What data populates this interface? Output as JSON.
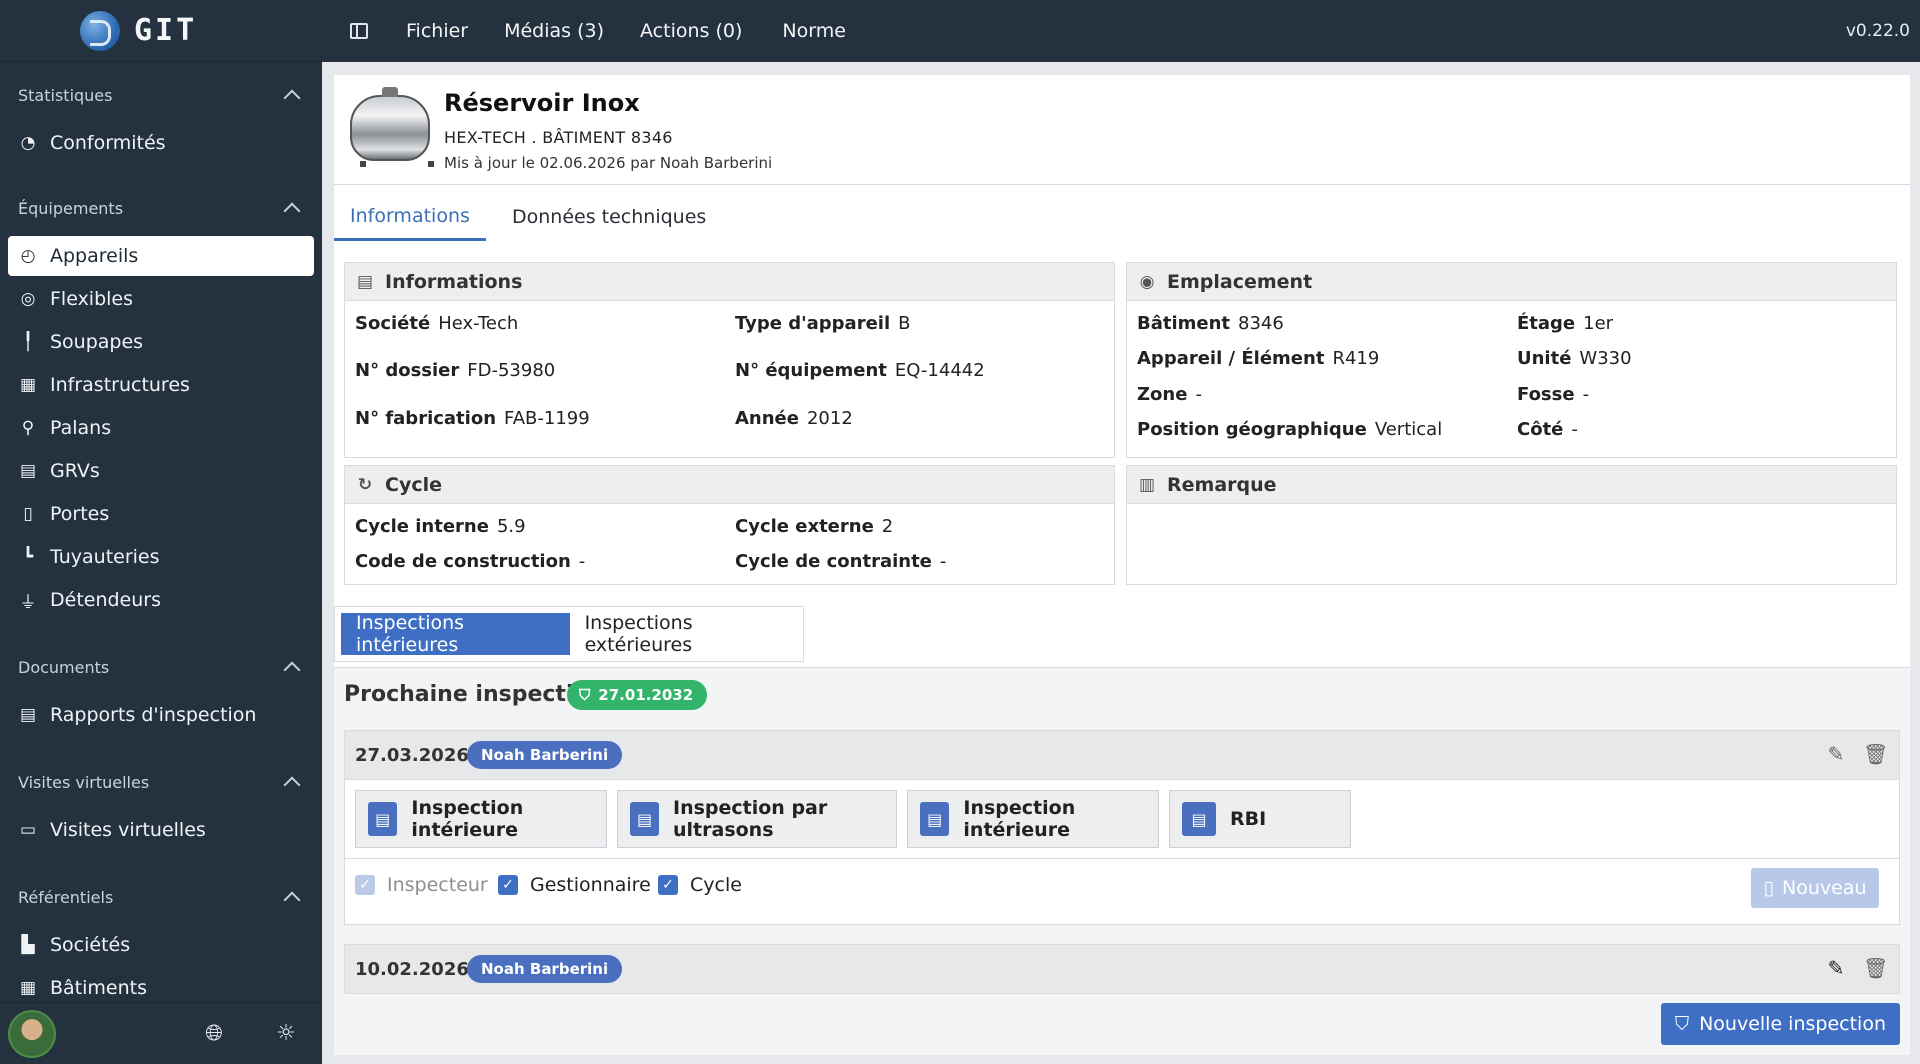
{
  "app": {
    "name": "GIT",
    "version": "v0.22.0"
  },
  "topbar": {
    "menu": [
      "Fichier",
      "Médias (3)",
      "Actions (0)",
      "Norme"
    ]
  },
  "sidebar": {
    "sections": [
      {
        "title": "Statistiques",
        "items": [
          {
            "label": "Conformités",
            "icon": "pie-chart-icon"
          }
        ]
      },
      {
        "title": "Équipements",
        "items": [
          {
            "label": "Appareils",
            "icon": "gauge-icon",
            "active": true
          },
          {
            "label": "Flexibles",
            "icon": "coil-icon"
          },
          {
            "label": "Soupapes",
            "icon": "valve-icon"
          },
          {
            "label": "Infrastructures",
            "icon": "building-icon"
          },
          {
            "label": "Palans",
            "icon": "hoist-icon"
          },
          {
            "label": "GRVs",
            "icon": "container-icon"
          },
          {
            "label": "Portes",
            "icon": "door-icon"
          },
          {
            "label": "Tuyauteries",
            "icon": "pipe-icon"
          },
          {
            "label": "Détendeurs",
            "icon": "regulator-icon"
          }
        ]
      },
      {
        "title": "Documents",
        "items": [
          {
            "label": "Rapports d'inspection",
            "icon": "document-icon"
          }
        ]
      },
      {
        "title": "Visites virtuelles",
        "items": [
          {
            "label": "Visites virtuelles",
            "icon": "panorama-icon"
          }
        ]
      },
      {
        "title": "Référentiels",
        "items": [
          {
            "label": "Sociétés",
            "icon": "factory-icon"
          },
          {
            "label": "Bâtiments",
            "icon": "building-icon"
          }
        ]
      }
    ]
  },
  "equipment": {
    "title": "Réservoir Inox",
    "subtitle": "HEX-TECH . BÂTIMENT 8346",
    "updated": "Mis à jour le 02.06.2026 par Noah Barberini"
  },
  "tabs": {
    "informations": "Informations",
    "technical": "Données techniques"
  },
  "informations": {
    "title": "Informations",
    "fields": [
      {
        "label": "Société",
        "value": "Hex-Tech"
      },
      {
        "label": "Type d'appareil",
        "value": "B"
      },
      {
        "label": "N° dossier",
        "value": "FD-53980"
      },
      {
        "label": "N° équipement",
        "value": "EQ-14442"
      },
      {
        "label": "N° fabrication",
        "value": "FAB-1199"
      },
      {
        "label": "Année",
        "value": "2012"
      }
    ]
  },
  "location": {
    "title": "Emplacement",
    "fields": [
      {
        "label": "Bâtiment",
        "value": "8346"
      },
      {
        "label": "Étage",
        "value": "1er"
      },
      {
        "label": "Appareil / Élément",
        "value": "R419"
      },
      {
        "label": "Unité",
        "value": "W330"
      },
      {
        "label": "Zone",
        "value": "-"
      },
      {
        "label": "Fosse",
        "value": "-"
      },
      {
        "label": "Position géographique",
        "value": "Vertical"
      },
      {
        "label": "Côté",
        "value": "-"
      }
    ]
  },
  "cycle": {
    "title": "Cycle",
    "fields": [
      {
        "label": "Cycle interne",
        "value": "5.9"
      },
      {
        "label": "Cycle externe",
        "value": "2"
      },
      {
        "label": "Code de construction",
        "value": "-"
      },
      {
        "label": "Cycle de contrainte",
        "value": "-"
      }
    ]
  },
  "remark": {
    "title": "Remarque"
  },
  "inspections": {
    "tabs": [
      "Inspections intérieures",
      "Inspections extérieures"
    ],
    "next_label": "Prochaine inspection:",
    "next_date": "27.01.2032",
    "entries": [
      {
        "date": "27.03.2026",
        "user": "Noah Barberini",
        "documents": [
          "Inspection intérieure",
          "Inspection par ultrasons",
          "Inspection intérieure",
          "RBI"
        ],
        "checks": [
          {
            "label": "Inspecteur",
            "disabled": true
          },
          {
            "label": "Gestionnaire"
          },
          {
            "label": "Cycle"
          }
        ],
        "new_label": "Nouveau"
      },
      {
        "date": "10.02.2026",
        "user": "Noah Barberini"
      }
    ],
    "new_inspection_label": "Nouvelle inspection"
  },
  "colors": {
    "sidebar": "#243240",
    "accent": "#3f6fc4",
    "success": "#32b56a"
  }
}
